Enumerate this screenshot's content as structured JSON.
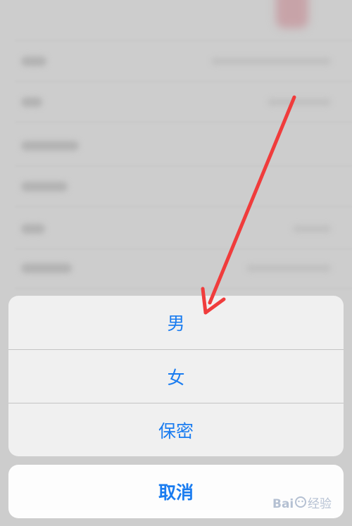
{
  "action_sheet": {
    "options": [
      {
        "label": "男"
      },
      {
        "label": "女"
      },
      {
        "label": "保密"
      }
    ],
    "cancel_label": "取消"
  },
  "colors": {
    "accent": "#1a7cf0",
    "annotation_arrow": "#f03c3c",
    "sheet_background": "#f0f0f0",
    "backdrop": "#cdcdcd"
  },
  "watermark": {
    "text": "Baidu 经验"
  }
}
